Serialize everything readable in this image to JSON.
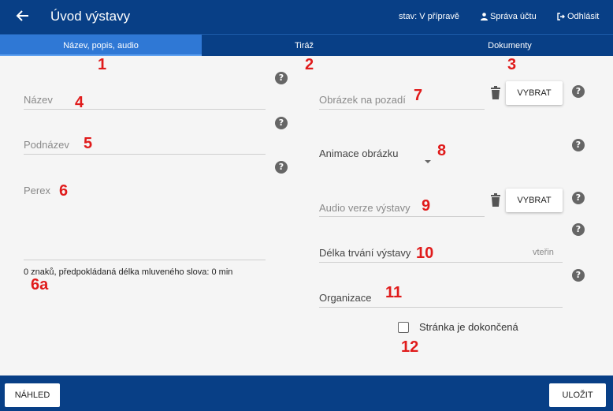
{
  "header": {
    "title": "Úvod výstavy",
    "status": "stav: V přípravě",
    "account_label": "Správa účtu",
    "logout_label": "Odhlásit"
  },
  "tabs": [
    {
      "label": "Název, popis, audio",
      "active": true
    },
    {
      "label": "Tiráž",
      "active": false
    },
    {
      "label": "Dokumenty",
      "active": false
    }
  ],
  "markers": {
    "m1": "1",
    "m2": "2",
    "m3": "3",
    "m4": "4",
    "m5": "5",
    "m6": "6",
    "m6a": "6a",
    "m7": "7",
    "m8": "8",
    "m9": "9",
    "m10": "10",
    "m11": "11",
    "m12": "12"
  },
  "left_form": {
    "name_label": "Název",
    "subtitle_label": "Podnázev",
    "perex_label": "Perex",
    "counter_text": "0 znaků, předpokládaná délka mluveného slova: 0 min"
  },
  "right_form": {
    "background_image_label": "Obrázek na pozadí",
    "choose_label": "VYBRAT",
    "animation_label": "Animace obrázku",
    "audio_label": "Audio verze výstavy",
    "duration_label": "Délka trvání výstavy",
    "duration_unit": "vteřin",
    "organization_label": "Organizace",
    "completed_label": "Stránka je dokončená"
  },
  "footer": {
    "preview_label": "NÁHLED",
    "save_label": "ULOŽIT"
  },
  "help_glyph": "?",
  "colors": {
    "primary": "#083f86",
    "active_tab": "#2f78d5",
    "marker": "#e01b1b",
    "background": "#f5f5f5"
  }
}
